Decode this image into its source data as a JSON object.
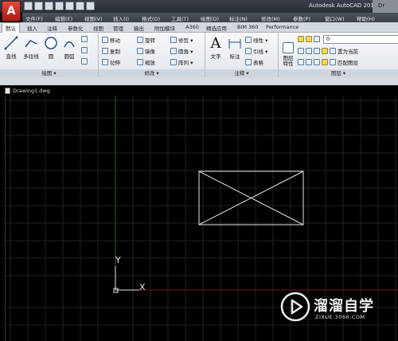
{
  "app": {
    "logo_letter": "A",
    "title": "Autodesk AutoCAD 2016",
    "title_right": "Dr"
  },
  "menu": [
    "文件(F)",
    "编辑(E)",
    "视图(V)",
    "插入(I)",
    "格式(O)",
    "工具(T)",
    "绘图(D)",
    "标注(N)",
    "修改(M)",
    "参数(P)",
    "窗口(W)",
    "帮助(H)"
  ],
  "tabs": [
    "默认",
    "插入",
    "注释",
    "参数化",
    "视图",
    "管理",
    "输出",
    "附加模块",
    "A360",
    "精选应用",
    "BIM 360",
    "Performance"
  ],
  "ribbon": {
    "draw": {
      "title": "绘图 ▾",
      "line": "直线",
      "polyline": "多段线",
      "circle": "圆",
      "arc": "圆弧"
    },
    "modify": {
      "title": "修改 ▾",
      "move": "移动",
      "rotate": "旋转",
      "trim": "修剪 ▾",
      "copy": "复制",
      "mirror": "镜像",
      "fillet": "圆角 ▾",
      "stretch": "拉伸",
      "scale": "缩放",
      "array": "阵列 ▾"
    },
    "annotation": {
      "title": "注释 ▾",
      "text": "文字",
      "dimension": "标注",
      "linear": "线性 ▾",
      "leader": "引线 ▾",
      "table": "表格"
    },
    "layers": {
      "title": "图层 ▾",
      "layer_props": "图层\n特性",
      "current_layer": "0",
      "set_current": "置为当前",
      "match_layer": "匹配图层"
    }
  },
  "document": {
    "tab": "Drawing1.dwg"
  },
  "ucs": {
    "x": "X",
    "y": "Y"
  },
  "watermark": {
    "brand": "溜溜自学",
    "url": "ZIXUE.3066.COM"
  }
}
